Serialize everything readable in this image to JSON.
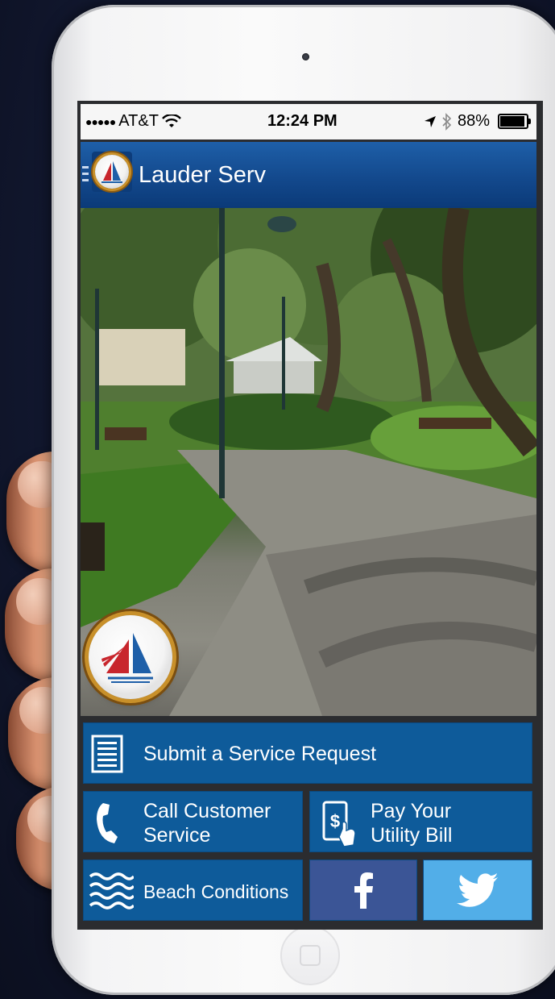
{
  "status_bar": {
    "carrier": "AT&T",
    "time": "12:24 PM",
    "battery": "88%",
    "battery_level": 0.88
  },
  "nav": {
    "title": "Lauder Serv"
  },
  "actions": {
    "service_request": "Submit a Service Request",
    "call_line1": "Call Customer",
    "call_line2": "Service",
    "pay_line1": "Pay Your",
    "pay_line2": "Utility Bill",
    "beach": "Beach Conditions"
  },
  "colors": {
    "nav_blue": "#13498d",
    "button_blue": "#0e5b9a",
    "facebook": "#3b5596",
    "twitter": "#52aee8",
    "logo_gold": "#c8902a",
    "logo_red": "#c8262d"
  },
  "icons": [
    "menu-icon",
    "wifi-icon",
    "location-arrow-icon",
    "bluetooth-icon",
    "battery-icon",
    "document-icon",
    "phone-icon",
    "pay-bill-icon",
    "waves-icon",
    "facebook-icon",
    "twitter-icon"
  ]
}
